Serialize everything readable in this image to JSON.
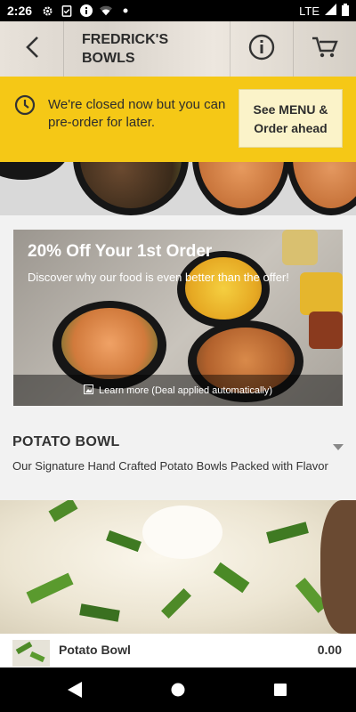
{
  "status_bar": {
    "time": "2:26",
    "network": "LTE"
  },
  "header": {
    "title": "FREDRICK'S BOWLS"
  },
  "closed_banner": {
    "message": "We're closed now but you can pre-order for later.",
    "button_label": "See MENU & Order ahead"
  },
  "promo": {
    "title": "20% Off Your 1st Order",
    "subtitle": "Discover why our food is even better than the offer!",
    "footer": "Learn more (Deal applied automatically)"
  },
  "section": {
    "name": "POTATO BOWL",
    "description": "Our Signature Hand Crafted Potato Bowls Packed with Flavor"
  },
  "item": {
    "name": "Potato Bowl",
    "price": "0.00"
  },
  "colors": {
    "accent": "#f5c816",
    "button_bg": "#fbf3c9"
  },
  "icons": [
    "settings-icon",
    "checklist-icon",
    "info-icon",
    "wifi-icon",
    "signal-icon",
    "battery-icon",
    "back-icon",
    "cart-icon",
    "clock-icon",
    "caret-down-icon",
    "home-icon",
    "recents-icon"
  ]
}
